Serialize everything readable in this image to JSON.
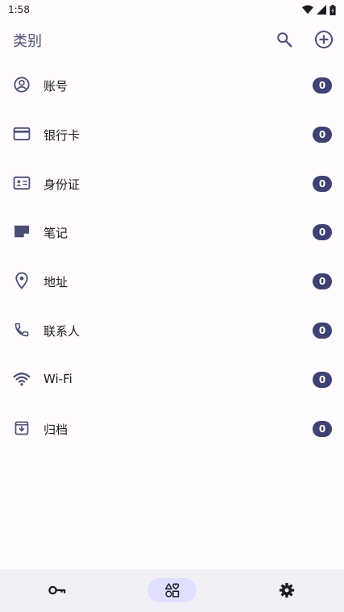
{
  "status_bar": {
    "time": "1:58",
    "icons": [
      "wifi-icon",
      "signal-icon",
      "battery-icon"
    ]
  },
  "app_bar": {
    "title": "类别",
    "actions": [
      "search-icon",
      "add-circle-icon"
    ]
  },
  "categories": [
    {
      "label": "账号",
      "count": "0",
      "icon": "account-circle-icon"
    },
    {
      "label": "银行卡",
      "count": "0",
      "icon": "credit-card-icon"
    },
    {
      "label": "身份证",
      "count": "0",
      "icon": "id-card-icon"
    },
    {
      "label": "笔记",
      "count": "0",
      "icon": "note-icon"
    },
    {
      "label": "地址",
      "count": "0",
      "icon": "location-pin-icon"
    },
    {
      "label": "联系人",
      "count": "0",
      "icon": "phone-icon"
    },
    {
      "label": "Wi-Fi",
      "count": "0",
      "icon": "wifi-icon"
    },
    {
      "label": "归档",
      "count": "0",
      "icon": "archive-icon"
    }
  ],
  "bottom_nav": {
    "items": [
      "key-icon",
      "categories-icon",
      "settings-icon"
    ],
    "active_index": 1
  },
  "colors": {
    "background": "#fffbfe",
    "accent": "#4b4f76",
    "badge": "#3d4273",
    "nav_background": "#f1eff6",
    "nav_active": "#dfe0ff"
  }
}
